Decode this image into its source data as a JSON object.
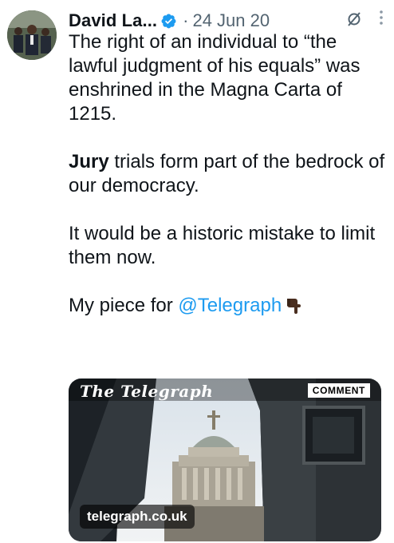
{
  "tweet": {
    "author_name": "David La...",
    "separator": "·",
    "date": "24 Jun 20",
    "paragraphs": {
      "p1": "The right of an individual to “the lawful judgment of his equals” was enshrined in the Magna Carta of 1215.",
      "p2_bold": "Jury",
      "p2_rest": " trials form part of the bedrock of our democracy.",
      "p3": "It would be a historic mistake to limit them now.",
      "p4": "My piece for ",
      "p4_mention": "@Telegraph"
    },
    "emoji": "backhand-index-pointing-down"
  },
  "card": {
    "masthead": "The Telegraph",
    "badge": "COMMENT",
    "domain": "telegraph.co.uk"
  },
  "colors": {
    "verified": "#1d9bf0",
    "link": "#1d9bf0",
    "muted": "#536471"
  }
}
